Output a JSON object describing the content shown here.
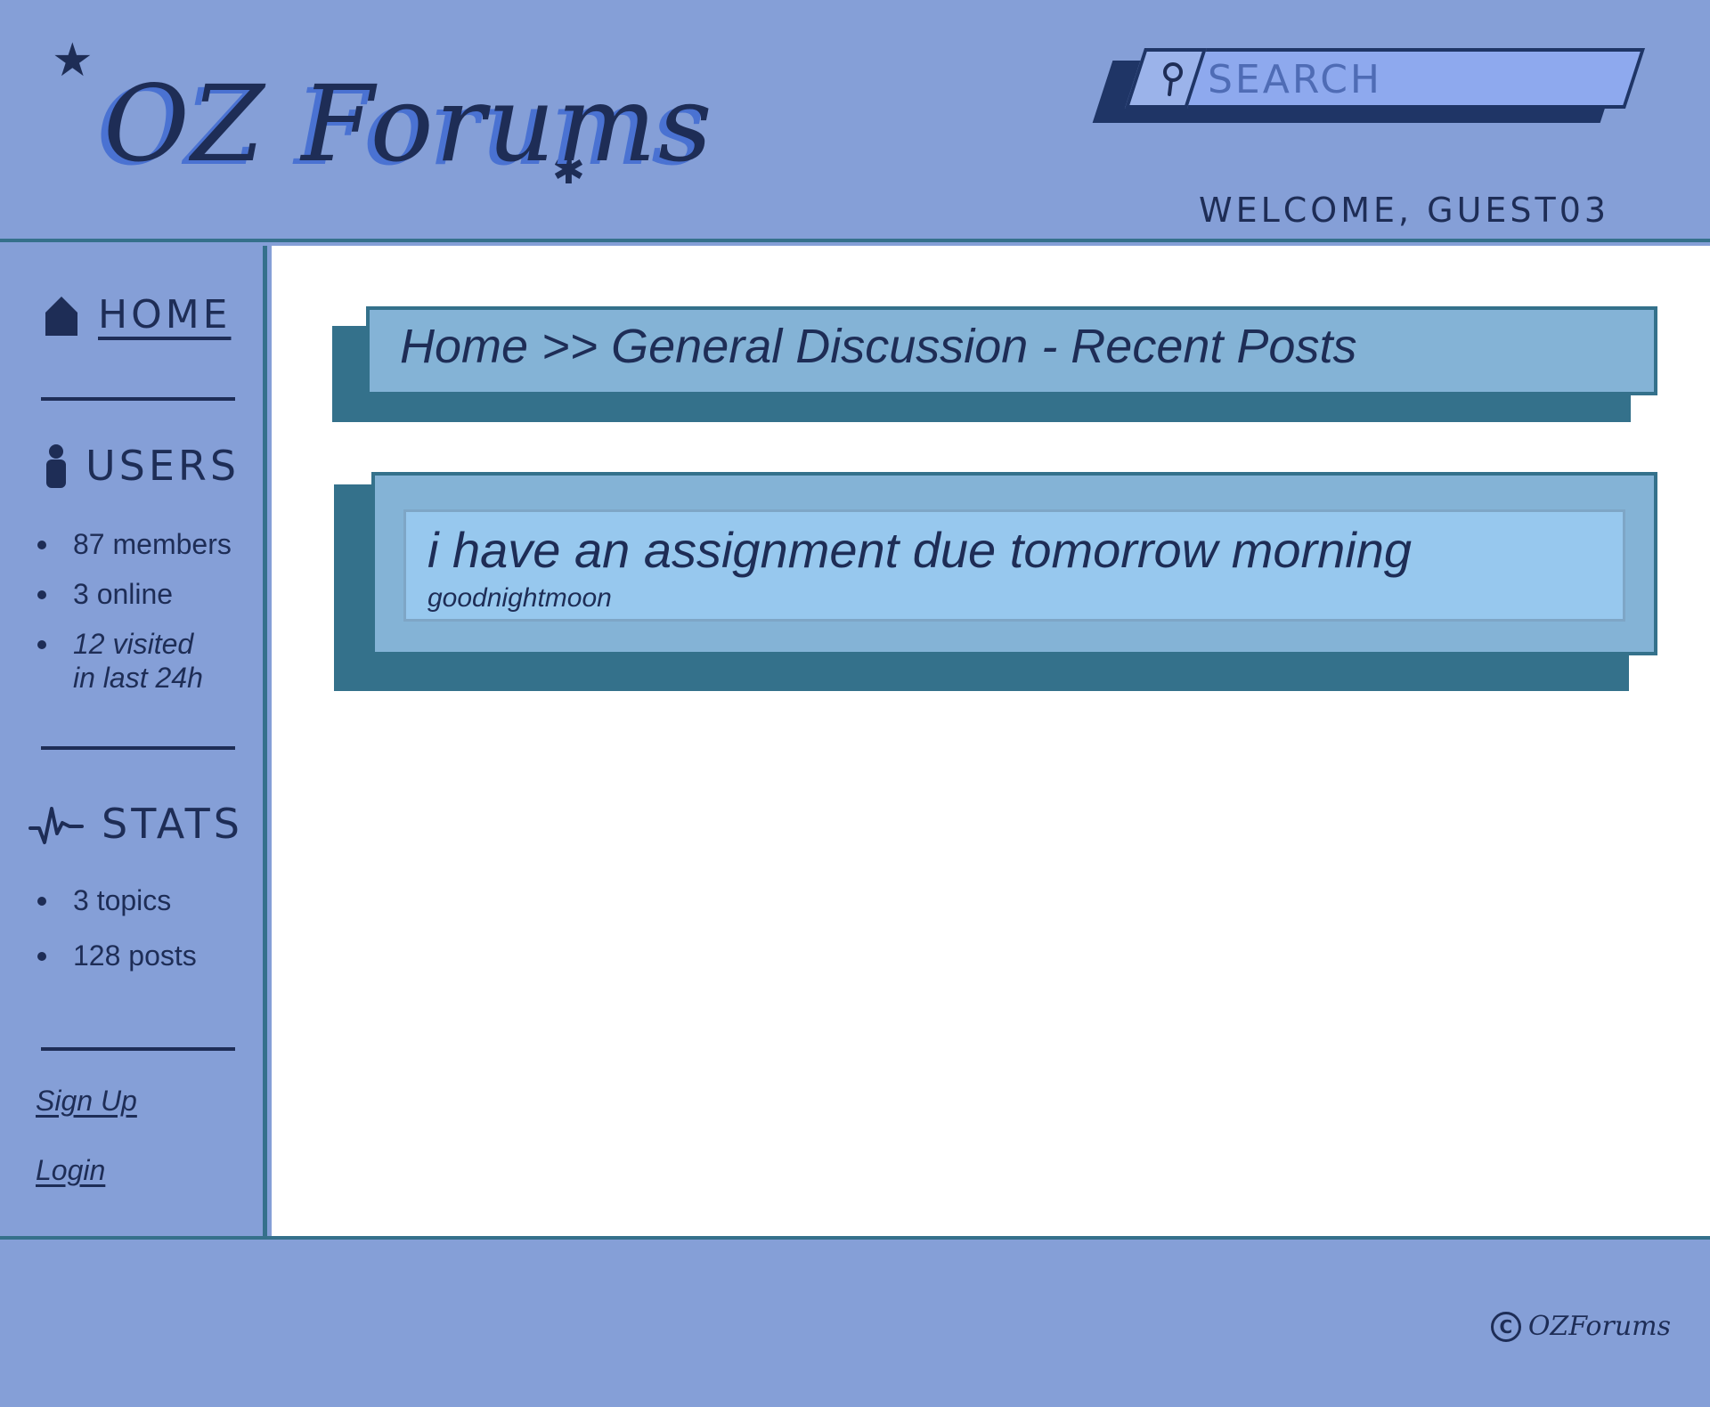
{
  "header": {
    "logo": "OZ Forums",
    "search_placeholder": "SEARCH",
    "welcome": "WELCOME, GUEST03"
  },
  "sidebar": {
    "home_label": "HOME",
    "users_label": "USERS",
    "users_stats": [
      "87 members",
      "3 online",
      "12 visited\nin last 24h"
    ],
    "stats_label": "STATS",
    "forum_stats": [
      "3 topics",
      "128 posts"
    ],
    "signup_label": "Sign Up",
    "login_label": "Login"
  },
  "main": {
    "breadcrumb": "Home >> General Discussion - Recent Posts",
    "posts": [
      {
        "title": "i have an assignment due tomorrow morning",
        "author": "goodnightmoon"
      }
    ]
  },
  "footer": {
    "copyright_symbol": "C",
    "copyright_text": "OZForums"
  },
  "colors": {
    "background": "#859fd7",
    "ink": "#1e2d56",
    "panel": "#84b3d6",
    "panel_shadow": "#34718b",
    "post_card": "#97c8ee",
    "search_field": "#8ea9ee",
    "logo_shadow": "#4a72d2"
  }
}
